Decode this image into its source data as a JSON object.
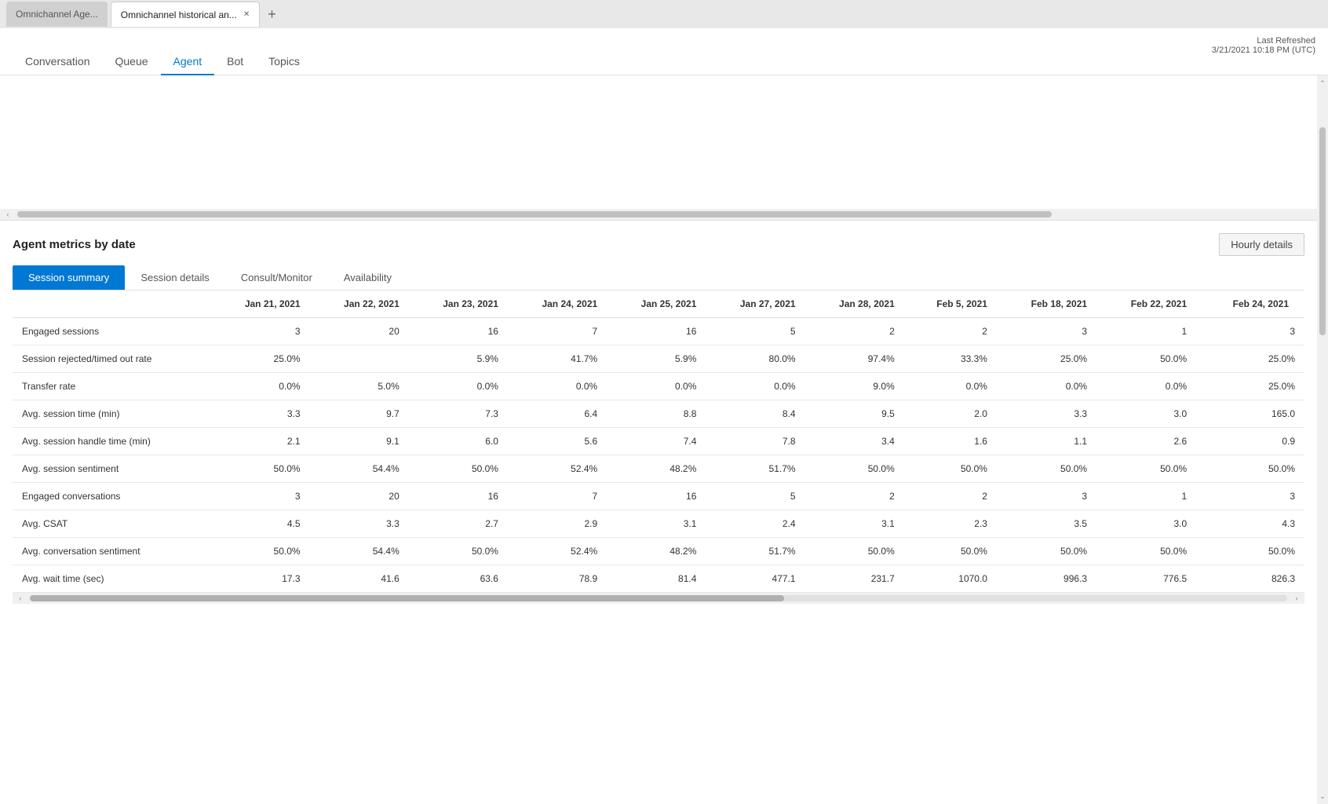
{
  "browser": {
    "tabs": [
      {
        "id": "tab1",
        "label": "Omnichannel Age...",
        "active": false
      },
      {
        "id": "tab2",
        "label": "Omnichannel historical an...",
        "active": true
      }
    ],
    "add_tab_label": "+"
  },
  "nav": {
    "items": [
      {
        "id": "conversation",
        "label": "Conversation",
        "active": false
      },
      {
        "id": "queue",
        "label": "Queue",
        "active": false
      },
      {
        "id": "agent",
        "label": "Agent",
        "active": true
      },
      {
        "id": "bot",
        "label": "Bot",
        "active": false
      },
      {
        "id": "topics",
        "label": "Topics",
        "active": false
      }
    ],
    "last_refreshed_label": "Last Refreshed",
    "last_refreshed_value": "3/21/2021 10:18 PM (UTC)"
  },
  "section": {
    "title": "Agent metrics by date",
    "hourly_details_btn": "Hourly details",
    "sub_tabs": [
      {
        "id": "session_summary",
        "label": "Session summary",
        "active": true
      },
      {
        "id": "session_details",
        "label": "Session details",
        "active": false
      },
      {
        "id": "consult_monitor",
        "label": "Consult/Monitor",
        "active": false
      },
      {
        "id": "availability",
        "label": "Availability",
        "active": false
      }
    ]
  },
  "table": {
    "columns": [
      {
        "id": "metric",
        "label": ""
      },
      {
        "id": "jan21",
        "label": "Jan 21, 2021"
      },
      {
        "id": "jan22",
        "label": "Jan 22, 2021"
      },
      {
        "id": "jan23",
        "label": "Jan 23, 2021"
      },
      {
        "id": "jan24",
        "label": "Jan 24, 2021"
      },
      {
        "id": "jan25",
        "label": "Jan 25, 2021"
      },
      {
        "id": "jan27",
        "label": "Jan 27, 2021"
      },
      {
        "id": "jan28",
        "label": "Jan 28, 2021"
      },
      {
        "id": "feb5",
        "label": "Feb 5, 2021"
      },
      {
        "id": "feb18",
        "label": "Feb 18, 2021"
      },
      {
        "id": "feb22",
        "label": "Feb 22, 2021"
      },
      {
        "id": "feb24",
        "label": "Feb 24, 2021"
      }
    ],
    "rows": [
      {
        "metric": "Engaged sessions",
        "jan21": "3",
        "jan22": "20",
        "jan23": "16",
        "jan24": "7",
        "jan25": "16",
        "jan27": "5",
        "jan28": "2",
        "feb5": "2",
        "feb18": "3",
        "feb22": "1",
        "feb24": "3"
      },
      {
        "metric": "Session rejected/timed out rate",
        "jan21": "25.0%",
        "jan22": "",
        "jan23": "5.9%",
        "jan24": "41.7%",
        "jan25": "5.9%",
        "jan27": "80.0%",
        "jan28": "97.4%",
        "feb5": "33.3%",
        "feb18": "25.0%",
        "feb22": "50.0%",
        "feb24": "25.0%"
      },
      {
        "metric": "Transfer rate",
        "jan21": "0.0%",
        "jan22": "5.0%",
        "jan23": "0.0%",
        "jan24": "0.0%",
        "jan25": "0.0%",
        "jan27": "0.0%",
        "jan28": "9.0%",
        "feb5": "0.0%",
        "feb18": "0.0%",
        "feb22": "0.0%",
        "feb24": "25.0%"
      },
      {
        "metric": "Avg. session time (min)",
        "jan21": "3.3",
        "jan22": "9.7",
        "jan23": "7.3",
        "jan24": "6.4",
        "jan25": "8.8",
        "jan27": "8.4",
        "jan28": "9.5",
        "feb5": "2.0",
        "feb18": "3.3",
        "feb22": "3.0",
        "feb24": "165.0"
      },
      {
        "metric": "Avg. session handle time (min)",
        "jan21": "2.1",
        "jan22": "9.1",
        "jan23": "6.0",
        "jan24": "5.6",
        "jan25": "7.4",
        "jan27": "7.8",
        "jan28": "3.4",
        "feb5": "1.6",
        "feb18": "1.1",
        "feb22": "2.6",
        "feb24": "0.9"
      },
      {
        "metric": "Avg. session sentiment",
        "jan21": "50.0%",
        "jan22": "54.4%",
        "jan23": "50.0%",
        "jan24": "52.4%",
        "jan25": "48.2%",
        "jan27": "51.7%",
        "jan28": "50.0%",
        "feb5": "50.0%",
        "feb18": "50.0%",
        "feb22": "50.0%",
        "feb24": "50.0%"
      },
      {
        "metric": "Engaged conversations",
        "jan21": "3",
        "jan22": "20",
        "jan23": "16",
        "jan24": "7",
        "jan25": "16",
        "jan27": "5",
        "jan28": "2",
        "feb5": "2",
        "feb18": "3",
        "feb22": "1",
        "feb24": "3"
      },
      {
        "metric": "Avg. CSAT",
        "jan21": "4.5",
        "jan22": "3.3",
        "jan23": "2.7",
        "jan24": "2.9",
        "jan25": "3.1",
        "jan27": "2.4",
        "jan28": "3.1",
        "feb5": "2.3",
        "feb18": "3.5",
        "feb22": "3.0",
        "feb24": "4.3"
      },
      {
        "metric": "Avg. conversation sentiment",
        "jan21": "50.0%",
        "jan22": "54.4%",
        "jan23": "50.0%",
        "jan24": "52.4%",
        "jan25": "48.2%",
        "jan27": "51.7%",
        "jan28": "50.0%",
        "feb5": "50.0%",
        "feb18": "50.0%",
        "feb22": "50.0%",
        "feb24": "50.0%"
      },
      {
        "metric": "Avg. wait time (sec)",
        "jan21": "17.3",
        "jan22": "41.6",
        "jan23": "63.6",
        "jan24": "78.9",
        "jan25": "81.4",
        "jan27": "477.1",
        "jan28": "231.7",
        "feb5": "1070.0",
        "feb18": "996.3",
        "feb22": "776.5",
        "feb24": "826.3"
      }
    ]
  }
}
